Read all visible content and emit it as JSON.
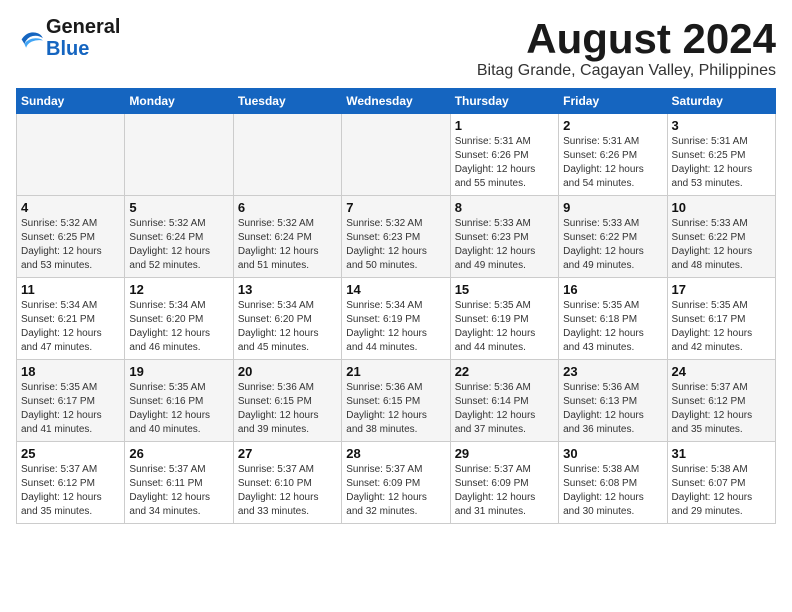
{
  "header": {
    "logo_general": "General",
    "logo_blue": "Blue",
    "month_title": "August 2024",
    "location": "Bitag Grande, Cagayan Valley, Philippines"
  },
  "calendar": {
    "days_of_week": [
      "Sunday",
      "Monday",
      "Tuesday",
      "Wednesday",
      "Thursday",
      "Friday",
      "Saturday"
    ],
    "weeks": [
      [
        {
          "day": "",
          "info": ""
        },
        {
          "day": "",
          "info": ""
        },
        {
          "day": "",
          "info": ""
        },
        {
          "day": "",
          "info": ""
        },
        {
          "day": "1",
          "info": "Sunrise: 5:31 AM\nSunset: 6:26 PM\nDaylight: 12 hours\nand 55 minutes."
        },
        {
          "day": "2",
          "info": "Sunrise: 5:31 AM\nSunset: 6:26 PM\nDaylight: 12 hours\nand 54 minutes."
        },
        {
          "day": "3",
          "info": "Sunrise: 5:31 AM\nSunset: 6:25 PM\nDaylight: 12 hours\nand 53 minutes."
        }
      ],
      [
        {
          "day": "4",
          "info": "Sunrise: 5:32 AM\nSunset: 6:25 PM\nDaylight: 12 hours\nand 53 minutes."
        },
        {
          "day": "5",
          "info": "Sunrise: 5:32 AM\nSunset: 6:24 PM\nDaylight: 12 hours\nand 52 minutes."
        },
        {
          "day": "6",
          "info": "Sunrise: 5:32 AM\nSunset: 6:24 PM\nDaylight: 12 hours\nand 51 minutes."
        },
        {
          "day": "7",
          "info": "Sunrise: 5:32 AM\nSunset: 6:23 PM\nDaylight: 12 hours\nand 50 minutes."
        },
        {
          "day": "8",
          "info": "Sunrise: 5:33 AM\nSunset: 6:23 PM\nDaylight: 12 hours\nand 49 minutes."
        },
        {
          "day": "9",
          "info": "Sunrise: 5:33 AM\nSunset: 6:22 PM\nDaylight: 12 hours\nand 49 minutes."
        },
        {
          "day": "10",
          "info": "Sunrise: 5:33 AM\nSunset: 6:22 PM\nDaylight: 12 hours\nand 48 minutes."
        }
      ],
      [
        {
          "day": "11",
          "info": "Sunrise: 5:34 AM\nSunset: 6:21 PM\nDaylight: 12 hours\nand 47 minutes."
        },
        {
          "day": "12",
          "info": "Sunrise: 5:34 AM\nSunset: 6:20 PM\nDaylight: 12 hours\nand 46 minutes."
        },
        {
          "day": "13",
          "info": "Sunrise: 5:34 AM\nSunset: 6:20 PM\nDaylight: 12 hours\nand 45 minutes."
        },
        {
          "day": "14",
          "info": "Sunrise: 5:34 AM\nSunset: 6:19 PM\nDaylight: 12 hours\nand 44 minutes."
        },
        {
          "day": "15",
          "info": "Sunrise: 5:35 AM\nSunset: 6:19 PM\nDaylight: 12 hours\nand 44 minutes."
        },
        {
          "day": "16",
          "info": "Sunrise: 5:35 AM\nSunset: 6:18 PM\nDaylight: 12 hours\nand 43 minutes."
        },
        {
          "day": "17",
          "info": "Sunrise: 5:35 AM\nSunset: 6:17 PM\nDaylight: 12 hours\nand 42 minutes."
        }
      ],
      [
        {
          "day": "18",
          "info": "Sunrise: 5:35 AM\nSunset: 6:17 PM\nDaylight: 12 hours\nand 41 minutes."
        },
        {
          "day": "19",
          "info": "Sunrise: 5:35 AM\nSunset: 6:16 PM\nDaylight: 12 hours\nand 40 minutes."
        },
        {
          "day": "20",
          "info": "Sunrise: 5:36 AM\nSunset: 6:15 PM\nDaylight: 12 hours\nand 39 minutes."
        },
        {
          "day": "21",
          "info": "Sunrise: 5:36 AM\nSunset: 6:15 PM\nDaylight: 12 hours\nand 38 minutes."
        },
        {
          "day": "22",
          "info": "Sunrise: 5:36 AM\nSunset: 6:14 PM\nDaylight: 12 hours\nand 37 minutes."
        },
        {
          "day": "23",
          "info": "Sunrise: 5:36 AM\nSunset: 6:13 PM\nDaylight: 12 hours\nand 36 minutes."
        },
        {
          "day": "24",
          "info": "Sunrise: 5:37 AM\nSunset: 6:12 PM\nDaylight: 12 hours\nand 35 minutes."
        }
      ],
      [
        {
          "day": "25",
          "info": "Sunrise: 5:37 AM\nSunset: 6:12 PM\nDaylight: 12 hours\nand 35 minutes."
        },
        {
          "day": "26",
          "info": "Sunrise: 5:37 AM\nSunset: 6:11 PM\nDaylight: 12 hours\nand 34 minutes."
        },
        {
          "day": "27",
          "info": "Sunrise: 5:37 AM\nSunset: 6:10 PM\nDaylight: 12 hours\nand 33 minutes."
        },
        {
          "day": "28",
          "info": "Sunrise: 5:37 AM\nSunset: 6:09 PM\nDaylight: 12 hours\nand 32 minutes."
        },
        {
          "day": "29",
          "info": "Sunrise: 5:37 AM\nSunset: 6:09 PM\nDaylight: 12 hours\nand 31 minutes."
        },
        {
          "day": "30",
          "info": "Sunrise: 5:38 AM\nSunset: 6:08 PM\nDaylight: 12 hours\nand 30 minutes."
        },
        {
          "day": "31",
          "info": "Sunrise: 5:38 AM\nSunset: 6:07 PM\nDaylight: 12 hours\nand 29 minutes."
        }
      ]
    ]
  }
}
